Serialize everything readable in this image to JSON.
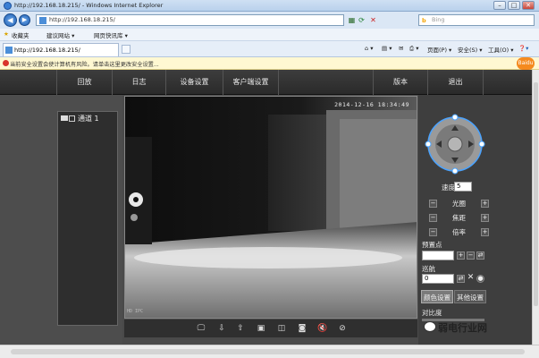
{
  "window": {
    "title": "http://192.168.18.215/ - Windows Internet Explorer",
    "buttons": [
      "–",
      "□",
      "✕"
    ]
  },
  "addressbar": {
    "url": "http://192.168.18.215/",
    "search_placeholder": "Bing",
    "back": "◀",
    "forward": "▶"
  },
  "favorites": {
    "label": "收藏夹",
    "items": [
      "建议网站 ▾",
      "网页快讯库 ▾"
    ]
  },
  "tab": {
    "label": "http://192.168.18.215/"
  },
  "commandbar": {
    "items": [
      "页面(P) ▾",
      "安全(S) ▾",
      "工具(O) ▾"
    ]
  },
  "infobar": {
    "text": "当前安全设置会使计算机有风险。请单击这里更改安全设置..."
  },
  "baidu": "Baidu",
  "nav": {
    "items": [
      "回放",
      "日志",
      "设备设置",
      "客户端设置",
      "版本",
      "退出"
    ]
  },
  "channels": [
    {
      "label": "通道 1"
    }
  ],
  "video": {
    "timestamp": "2014-12-16 18:34:49",
    "corner_label": "HD IPC"
  },
  "video_toolbar": [
    "monitor-icon",
    "import-icon",
    "export-icon",
    "record-icon",
    "split-icon",
    "snapshot-icon",
    "mute-icon",
    "stop-icon"
  ],
  "ptz": {
    "speed_label": "速度",
    "speed_value": "5",
    "controls": [
      {
        "label": "光圈"
      },
      {
        "label": "焦距"
      },
      {
        "label": "倍率"
      }
    ],
    "preset_label": "预置点",
    "preset_value": "",
    "cruise_label": "巡航",
    "cruise_value": "0",
    "tabs": [
      "颜色设置",
      "其他设置"
    ],
    "contrast_label": "对比度"
  },
  "watermark": "弱电行业网",
  "colors": {
    "navbar": "#2f2f2f",
    "panel": "#3e3e3e",
    "accent": "#4aa3ff"
  }
}
